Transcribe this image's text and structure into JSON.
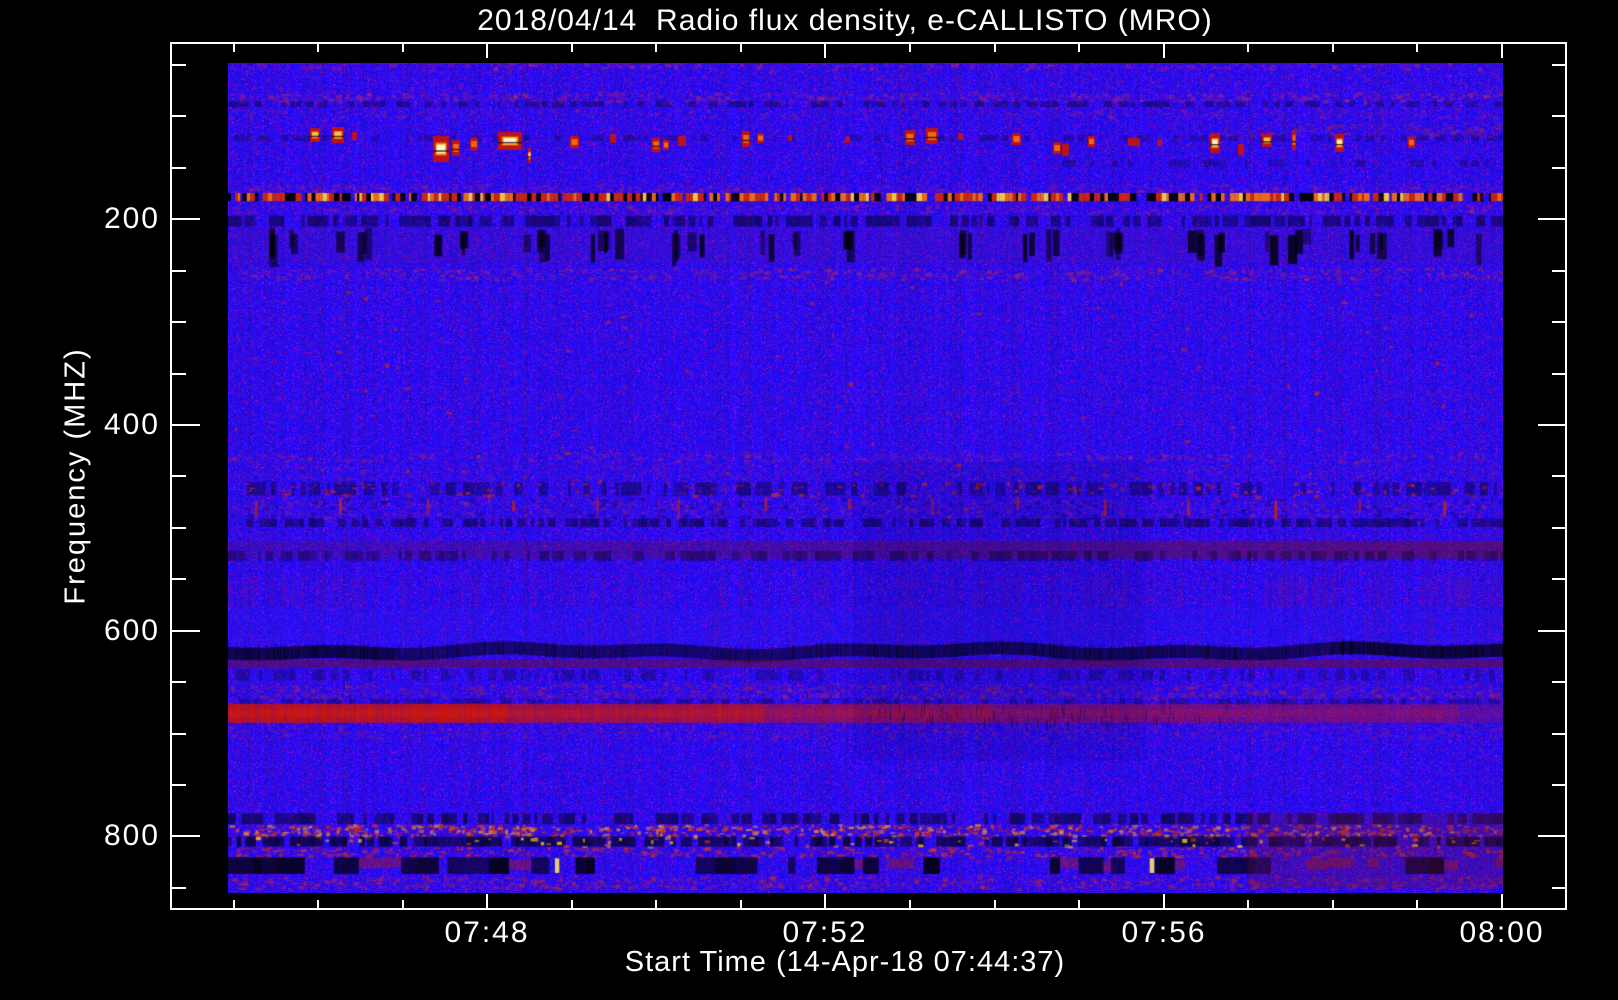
{
  "figure": {
    "background": "#000000",
    "frame_color": "#ffffff",
    "text_color": "#ffffff"
  },
  "chart_data": {
    "type": "heatmap",
    "subtype": "radio-spectrogram",
    "title": "2018/04/14  Radio flux density, e-CALLISTO (MRO)",
    "x_axis": {
      "label": "Start Time (14-Apr-18 07:44:37)",
      "tick_labels": [
        "07:48",
        "07:52",
        "07:56",
        "08:00"
      ],
      "start": "07:44:37",
      "end": "08:00",
      "minor_tick_minutes": 1
    },
    "y_axis": {
      "label": "Frequency (MHZ)",
      "tick_labels": [
        200,
        400,
        600,
        800
      ],
      "minor_tick_mhz": 50,
      "range_mhz": [
        48,
        855
      ],
      "direction": "increasing-downward"
    },
    "palette": {
      "base_blue": "#2213e8",
      "purple": "#7a1890",
      "dark_navy": "#05041e",
      "red": "#c81408",
      "orange": "#f07010",
      "yellow": "#f8d040",
      "white_hot": "#fffbe0"
    },
    "features": [
      {
        "f_mhz": [
          88,
          135
        ],
        "desc": "sporadic bright FM broadcast bursts (red blocks with yellow/white cores)"
      },
      {
        "f_mhz": 178,
        "desc": "dashed horizontal RFI line of red/orange/yellow dots across full duration"
      },
      {
        "f_mhz": [
          210,
          240
        ],
        "desc": "periodic groups of dark fades, ~1 minute period"
      },
      {
        "f_mhz": [
          430,
          500
        ],
        "desc": "speckled RFI rows with red dots and dark dashes"
      },
      {
        "f_mhz": [
          545,
          560
        ],
        "desc": "dark red band, stronger toward the right"
      },
      {
        "f_mhz": [
          612,
          626
        ],
        "desc": "dark absorption-like band across full duration, darkest at far right"
      },
      {
        "f_mhz": [
          670,
          688
        ],
        "desc": "strong red emission band, brightest at left edge"
      },
      {
        "f_mhz": [
          775,
          840
        ],
        "desc": "broadband RFI: dark and red speckled rows with occasional yellow bursts"
      }
    ],
    "render": {
      "blob": {
        "start": 0.0165,
        "period": 0.06635,
        "width": 44
      },
      "bands": [
        {
          "yf": [
            0.0,
            0.006
          ],
          "type": "spk",
          "colors": [
            "#8a1a9a",
            "#b03060",
            "#5a10c0"
          ],
          "density": 1.6,
          "alpha": 0.55
        },
        {
          "yf": [
            0.006,
            0.034
          ],
          "type": "spk",
          "colors": [
            "#7a1a9a",
            "#a02868"
          ],
          "density": 0.35,
          "alpha": 0.3
        },
        {
          "yf": [
            0.035,
            0.046
          ],
          "type": "spk",
          "colors": [
            "#9a2080",
            "#c03050",
            "#6a14b0"
          ],
          "density": 1.5,
          "alpha": 0.5
        },
        {
          "yf": [
            0.046,
            0.053
          ],
          "type": "dash",
          "color": "#0a0632",
          "prob": 0.5,
          "alpha": 0.5
        },
        {
          "yf": [
            0.054,
            0.066
          ],
          "type": "spk",
          "colors": [
            "#8a1a9a",
            "#a82a60"
          ],
          "density": 0.8,
          "alpha": 0.35
        },
        {
          "yf": [
            0.075,
            0.122
          ],
          "type": "spk",
          "colors": [
            "#7a1890",
            "#902a70"
          ],
          "density": 0.25,
          "alpha": 0.25
        },
        {
          "yf": [
            0.087,
            0.094
          ],
          "type": "dash",
          "color": "#0c0838",
          "prob": 0.4,
          "alpha": 0.4
        },
        {
          "yf": [
            0.072,
            0.089
          ],
          "xf": [
            0.78,
            1
          ],
          "type": "spk",
          "colors": [
            "#8a2050",
            "#a03060"
          ],
          "density": 1.2,
          "alpha": 0.4
        },
        {
          "yf": [
            0.117,
            0.125
          ],
          "xf": [
            0.65,
            1
          ],
          "type": "dash",
          "color": "#0a0630",
          "prob": 0.35,
          "alpha": 0.4
        },
        {
          "yf": [
            0.145,
            0.156
          ],
          "type": "spk",
          "colors": [
            "#8a1a9a",
            "#b02858",
            "#6a14b8"
          ],
          "density": 1.4,
          "alpha": 0.45
        },
        {
          "yf": [
            0.1566,
            0.1665
          ],
          "type": "dot",
          "segments": [
            [
              "#000005",
              0.26
            ],
            [
              "#d02808",
              0.3
            ],
            [
              "#f07010",
              0.21
            ],
            [
              "#f8d040",
              0.11
            ]
          ],
          "desc": "dashed RFI line ~178 MHz"
        },
        {
          "yf": [
            0.17,
            0.18
          ],
          "type": "spk",
          "colors": [
            "#8a1a9a",
            "#a82a66"
          ],
          "density": 1.2,
          "alpha": 0.4
        },
        {
          "yf": [
            0.184,
            0.197
          ],
          "type": "dash",
          "color": "#05041c",
          "prob": 0.6,
          "alpha": 0.6
        },
        {
          "yf": [
            0.199,
            0.241
          ],
          "type": "blob",
          "desc": "periodic dark fade groups ~210-240 MHz"
        },
        {
          "yf": [
            0.246,
            0.26
          ],
          "type": "spk",
          "colors": [
            "#9a2070",
            "#b83050",
            "#6a14b0"
          ],
          "density": 1.4,
          "alpha": 0.5
        },
        {
          "yf": [
            0.268,
            0.284
          ],
          "type": "spk",
          "colors": [
            "#7a1890"
          ],
          "density": 0.5,
          "alpha": 0.22
        },
        {
          "yf": [
            0.298,
            0.308
          ],
          "type": "spk",
          "colors": [
            "#7a1890",
            "#983070"
          ],
          "density": 0.6,
          "alpha": 0.22
        },
        {
          "yf": [
            0.328,
            0.337
          ],
          "type": "spk",
          "colors": [
            "#7a1890"
          ],
          "density": 0.4,
          "alpha": 0.16
        },
        {
          "yf": [
            0.389,
            0.407
          ],
          "type": "spk",
          "colors": [
            "#7a1890",
            "#902a70"
          ],
          "density": 0.55,
          "alpha": 0.22
        },
        {
          "yf": [
            0.418,
            0.431
          ],
          "type": "spk",
          "colors": [
            "#7a1890"
          ],
          "density": 0.45,
          "alpha": 0.2
        },
        {
          "yf": [
            0.26,
            0.56
          ],
          "type": "spk",
          "colors": [
            "#d02810"
          ],
          "density": 0.012,
          "alpha": 0.75
        },
        {
          "yf": [
            0.469,
            0.479
          ],
          "type": "spk",
          "colors": [
            "#8a1a9a",
            "#a82a66"
          ],
          "density": 1.1,
          "alpha": 0.4
        },
        {
          "yf": [
            0.482,
            0.5
          ],
          "type": "spk",
          "colors": [
            "#7a1890",
            "#8a2a80"
          ],
          "density": 0.8,
          "alpha": 0.3
        },
        {
          "yf": [
            0.505,
            0.521
          ],
          "type": "dash",
          "color": "#070528",
          "prob": 0.5,
          "alpha": 0.5
        },
        {
          "yf": [
            0.505,
            0.521
          ],
          "type": "spk",
          "colors": [
            "#c02010",
            "#d83010"
          ],
          "density": 0.25,
          "alpha": 0.7
        },
        {
          "yf": [
            0.523,
            0.548
          ],
          "type": "spk",
          "colors": [
            "#7a1890",
            "#983070",
            "#0a0630"
          ],
          "density": 1.0,
          "alpha": 0.38
        },
        {
          "yf": [
            0.523,
            0.548
          ],
          "type": "ticks",
          "color": "#c42412",
          "period": 0.0664,
          "phase": 0.022,
          "w": 3,
          "alpha": 0.8
        },
        {
          "yf": [
            0.549,
            0.559
          ],
          "type": "dash",
          "color": "#060424",
          "prob": 0.65,
          "alpha": 0.6
        },
        {
          "yf": [
            0.564,
            0.576
          ],
          "type": "spk",
          "colors": [
            "#7a1890"
          ],
          "density": 0.5,
          "alpha": 0.22
        },
        {
          "yf": [
            0.576,
            0.597
          ],
          "type": "tintramp",
          "color": "#701020",
          "a0": 0.18,
          "a1": 0.52,
          "desc": "dark red band ~545-560 MHz"
        },
        {
          "yf": [
            0.588,
            0.6
          ],
          "type": "dash",
          "color": "#080528",
          "prob": 0.5,
          "alpha": 0.45
        },
        {
          "yf": [
            0.619,
            0.656
          ],
          "type": "stripes",
          "color": "#6a1490",
          "prob": 0.42,
          "alpha": 0.26
        },
        {
          "yf": [
            0.619,
            0.656
          ],
          "xf": [
            0.8,
            1
          ],
          "type": "stripes",
          "color": "#6a1490",
          "prob": 0.5,
          "alpha": 0.3
        },
        {
          "yf": [
            0.656,
            0.7
          ],
          "type": "tint",
          "color": "#2a20ff",
          "alpha": 0.2
        },
        {
          "yf": [
            0.66,
            0.7
          ],
          "xf": [
            0.08,
            0.56
          ],
          "type": "stripes",
          "color": "#7a1880",
          "prob": 0.35,
          "alpha": 0.2
        },
        {
          "yf": [
            0.66,
            0.7
          ],
          "xf": [
            0.84,
            1
          ],
          "type": "stripes",
          "color": "#6a1490",
          "prob": 0.45,
          "alpha": 0.3
        },
        {
          "yf": [
            0.699,
            0.718
          ],
          "type": "dark",
          "color": "#04041e",
          "desc": "dark band ~612-626 MHz"
        },
        {
          "yf": [
            0.719,
            0.729
          ],
          "type": "tintramp",
          "color": "#6e0e1e",
          "a0": 0.45,
          "a1": 0.5
        },
        {
          "yf": [
            0.731,
            0.744
          ],
          "type": "dash",
          "color": "#0a0828",
          "prob": 0.4,
          "alpha": 0.35
        },
        {
          "yf": [
            0.747,
            0.765
          ],
          "type": "spk",
          "colors": [
            "#9a2060",
            "#b02848",
            "#6a14a0"
          ],
          "density": 1.3,
          "alpha": 0.5
        },
        {
          "yf": [
            0.766,
            0.773
          ],
          "type": "dash",
          "color": "#080628",
          "prob": 0.5,
          "alpha": 0.4
        },
        {
          "yf": [
            0.772,
            0.795
          ],
          "type": "red",
          "color": "#c81408",
          "core": "#e01e06",
          "mottle": "#100212",
          "desc": "strong red band ~670-688 MHz"
        },
        {
          "yf": [
            0.795,
            0.814
          ],
          "type": "spk",
          "colors": [
            "#8a1a80",
            "#982a60"
          ],
          "density": 0.9,
          "alpha": 0.35
        },
        {
          "yf": [
            0.816,
            0.877
          ],
          "type": "spk",
          "colors": [
            "#6a1488"
          ],
          "density": 0.3,
          "alpha": 0.14
        },
        {
          "yf": [
            0.48,
            0.84
          ],
          "xf": [
            0.49,
            0.72
          ],
          "type": "tint",
          "color": "#000040",
          "alpha": 0.1
        },
        {
          "yf": [
            0.55,
            0.8
          ],
          "xf": [
            0.8,
            0.995
          ],
          "type": "stripes",
          "color": "#5a1280",
          "prob": 0.3,
          "alpha": 0.14
        },
        {
          "yf": [
            0.904,
            0.917
          ],
          "type": "dash",
          "color": "#05041a",
          "prob": 0.6,
          "alpha": 0.65
        },
        {
          "yf": [
            0.917,
            0.931
          ],
          "type": "spk",
          "colors": [
            "#d02810",
            "#e04810",
            "#f0a020"
          ],
          "density": 1.6,
          "alpha": 0.75
        },
        {
          "yf": [
            0.932,
            0.944
          ],
          "type": "dash",
          "color": "#030312",
          "prob": 0.75,
          "alpha": 0.8
        },
        {
          "yf": [
            0.932,
            0.944
          ],
          "type": "spk",
          "colors": [
            "#f0c030",
            "#e05010"
          ],
          "density": 0.18,
          "alpha": 0.85
        },
        {
          "yf": [
            0.944,
            0.956
          ],
          "type": "spk",
          "colors": [
            "#c82410",
            "#e03c10"
          ],
          "density": 1.1,
          "alpha": 0.6
        },
        {
          "yf": [
            0.957,
            0.977
          ],
          "type": "blk",
          "dark": "#020208",
          "bright": [
            "#f8e060",
            "#f0a020"
          ],
          "red": "#a81a10",
          "desc": "RFI blocks with yellow bursts ~815-833 MHz"
        },
        {
          "yf": [
            0.979,
            0.994
          ],
          "type": "spk",
          "colors": [
            "#b02050",
            "#c83020",
            "#7a1890"
          ],
          "density": 1.3,
          "alpha": 0.55
        },
        {
          "yf": [
            0.904,
            0.994
          ],
          "xf": [
            0.8,
            1
          ],
          "type": "tint",
          "color": "#701025",
          "alpha": 0.25
        }
      ],
      "bursts": [
        [
          82,
          10,
          65,
          79,
          3
        ],
        [
          104,
          12,
          64,
          80,
          3
        ],
        [
          124,
          5,
          69,
          77,
          1
        ],
        [
          205,
          16,
          73,
          99,
          4
        ],
        [
          224,
          8,
          77,
          93,
          2
        ],
        [
          242,
          8,
          75,
          87,
          2
        ],
        [
          270,
          24,
          69,
          87,
          4
        ],
        [
          300,
          3,
          85,
          100,
          4
        ],
        [
          342,
          9,
          73,
          85,
          2
        ],
        [
          382,
          6,
          71,
          80,
          1
        ],
        [
          424,
          8,
          75,
          89,
          2
        ],
        [
          435,
          6,
          77,
          87,
          2
        ],
        [
          450,
          8,
          73,
          83,
          1
        ],
        [
          514,
          8,
          68,
          84,
          2
        ],
        [
          529,
          7,
          70,
          80,
          2
        ],
        [
          560,
          4,
          72,
          78,
          1
        ],
        [
          617,
          5,
          74,
          80,
          1
        ],
        [
          677,
          10,
          67,
          82,
          2
        ],
        [
          698,
          12,
          65,
          81,
          2
        ],
        [
          730,
          5,
          70,
          77,
          1
        ],
        [
          784,
          9,
          70,
          82,
          2
        ],
        [
          825,
          8,
          79,
          91,
          2
        ],
        [
          834,
          7,
          81,
          93,
          1
        ],
        [
          860,
          7,
          73,
          84,
          2
        ],
        [
          900,
          12,
          75,
          83,
          1
        ],
        [
          929,
          5,
          77,
          83,
          1
        ],
        [
          982,
          10,
          70,
          90,
          4
        ],
        [
          1010,
          6,
          81,
          92,
          1
        ],
        [
          1034,
          10,
          71,
          84,
          3
        ],
        [
          1064,
          4,
          67,
          87,
          2
        ],
        [
          1107,
          9,
          71,
          89,
          4
        ],
        [
          1180,
          7,
          74,
          85,
          2
        ]
      ]
    }
  }
}
